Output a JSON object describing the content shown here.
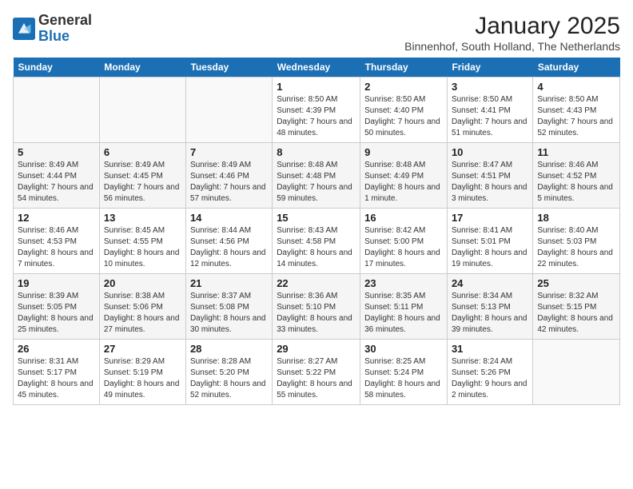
{
  "header": {
    "logo_line1": "General",
    "logo_line2": "Blue",
    "month": "January 2025",
    "location": "Binnenhof, South Holland, The Netherlands"
  },
  "days_of_week": [
    "Sunday",
    "Monday",
    "Tuesday",
    "Wednesday",
    "Thursday",
    "Friday",
    "Saturday"
  ],
  "weeks": [
    [
      {
        "day": "",
        "content": ""
      },
      {
        "day": "",
        "content": ""
      },
      {
        "day": "",
        "content": ""
      },
      {
        "day": "1",
        "content": "Sunrise: 8:50 AM\nSunset: 4:39 PM\nDaylight: 7 hours and 48 minutes."
      },
      {
        "day": "2",
        "content": "Sunrise: 8:50 AM\nSunset: 4:40 PM\nDaylight: 7 hours and 50 minutes."
      },
      {
        "day": "3",
        "content": "Sunrise: 8:50 AM\nSunset: 4:41 PM\nDaylight: 7 hours and 51 minutes."
      },
      {
        "day": "4",
        "content": "Sunrise: 8:50 AM\nSunset: 4:43 PM\nDaylight: 7 hours and 52 minutes."
      }
    ],
    [
      {
        "day": "5",
        "content": "Sunrise: 8:49 AM\nSunset: 4:44 PM\nDaylight: 7 hours and 54 minutes."
      },
      {
        "day": "6",
        "content": "Sunrise: 8:49 AM\nSunset: 4:45 PM\nDaylight: 7 hours and 56 minutes."
      },
      {
        "day": "7",
        "content": "Sunrise: 8:49 AM\nSunset: 4:46 PM\nDaylight: 7 hours and 57 minutes."
      },
      {
        "day": "8",
        "content": "Sunrise: 8:48 AM\nSunset: 4:48 PM\nDaylight: 7 hours and 59 minutes."
      },
      {
        "day": "9",
        "content": "Sunrise: 8:48 AM\nSunset: 4:49 PM\nDaylight: 8 hours and 1 minute."
      },
      {
        "day": "10",
        "content": "Sunrise: 8:47 AM\nSunset: 4:51 PM\nDaylight: 8 hours and 3 minutes."
      },
      {
        "day": "11",
        "content": "Sunrise: 8:46 AM\nSunset: 4:52 PM\nDaylight: 8 hours and 5 minutes."
      }
    ],
    [
      {
        "day": "12",
        "content": "Sunrise: 8:46 AM\nSunset: 4:53 PM\nDaylight: 8 hours and 7 minutes."
      },
      {
        "day": "13",
        "content": "Sunrise: 8:45 AM\nSunset: 4:55 PM\nDaylight: 8 hours and 10 minutes."
      },
      {
        "day": "14",
        "content": "Sunrise: 8:44 AM\nSunset: 4:56 PM\nDaylight: 8 hours and 12 minutes."
      },
      {
        "day": "15",
        "content": "Sunrise: 8:43 AM\nSunset: 4:58 PM\nDaylight: 8 hours and 14 minutes."
      },
      {
        "day": "16",
        "content": "Sunrise: 8:42 AM\nSunset: 5:00 PM\nDaylight: 8 hours and 17 minutes."
      },
      {
        "day": "17",
        "content": "Sunrise: 8:41 AM\nSunset: 5:01 PM\nDaylight: 8 hours and 19 minutes."
      },
      {
        "day": "18",
        "content": "Sunrise: 8:40 AM\nSunset: 5:03 PM\nDaylight: 8 hours and 22 minutes."
      }
    ],
    [
      {
        "day": "19",
        "content": "Sunrise: 8:39 AM\nSunset: 5:05 PM\nDaylight: 8 hours and 25 minutes."
      },
      {
        "day": "20",
        "content": "Sunrise: 8:38 AM\nSunset: 5:06 PM\nDaylight: 8 hours and 27 minutes."
      },
      {
        "day": "21",
        "content": "Sunrise: 8:37 AM\nSunset: 5:08 PM\nDaylight: 8 hours and 30 minutes."
      },
      {
        "day": "22",
        "content": "Sunrise: 8:36 AM\nSunset: 5:10 PM\nDaylight: 8 hours and 33 minutes."
      },
      {
        "day": "23",
        "content": "Sunrise: 8:35 AM\nSunset: 5:11 PM\nDaylight: 8 hours and 36 minutes."
      },
      {
        "day": "24",
        "content": "Sunrise: 8:34 AM\nSunset: 5:13 PM\nDaylight: 8 hours and 39 minutes."
      },
      {
        "day": "25",
        "content": "Sunrise: 8:32 AM\nSunset: 5:15 PM\nDaylight: 8 hours and 42 minutes."
      }
    ],
    [
      {
        "day": "26",
        "content": "Sunrise: 8:31 AM\nSunset: 5:17 PM\nDaylight: 8 hours and 45 minutes."
      },
      {
        "day": "27",
        "content": "Sunrise: 8:29 AM\nSunset: 5:19 PM\nDaylight: 8 hours and 49 minutes."
      },
      {
        "day": "28",
        "content": "Sunrise: 8:28 AM\nSunset: 5:20 PM\nDaylight: 8 hours and 52 minutes."
      },
      {
        "day": "29",
        "content": "Sunrise: 8:27 AM\nSunset: 5:22 PM\nDaylight: 8 hours and 55 minutes."
      },
      {
        "day": "30",
        "content": "Sunrise: 8:25 AM\nSunset: 5:24 PM\nDaylight: 8 hours and 58 minutes."
      },
      {
        "day": "31",
        "content": "Sunrise: 8:24 AM\nSunset: 5:26 PM\nDaylight: 9 hours and 2 minutes."
      },
      {
        "day": "",
        "content": ""
      }
    ]
  ]
}
